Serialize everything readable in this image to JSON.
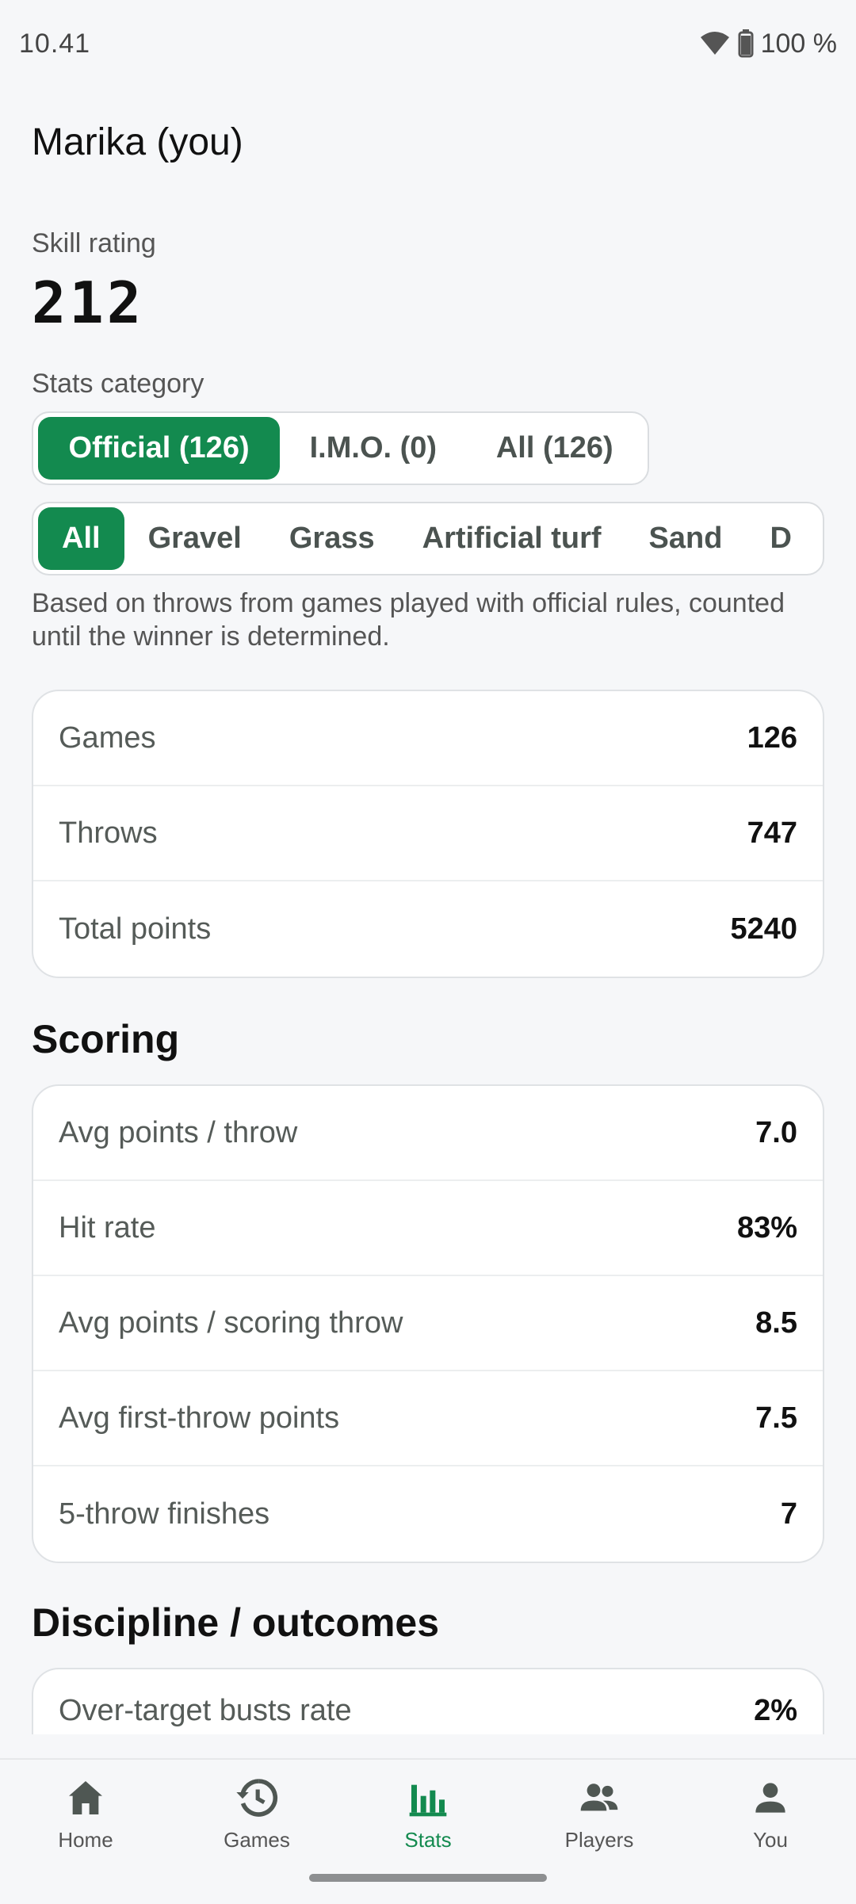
{
  "status_bar": {
    "time": "10.41",
    "battery": "100 %"
  },
  "player": {
    "name": "Marika (you)"
  },
  "skill": {
    "label": "Skill rating",
    "value": "212"
  },
  "stats_category": {
    "label": "Stats category",
    "options": [
      "Official (126)",
      "I.M.O. (0)",
      "All (126)"
    ],
    "selected": "Official (126)"
  },
  "surface_filter": {
    "options": [
      "All",
      "Gravel",
      "Grass",
      "Artificial turf",
      "Sand",
      "D"
    ],
    "selected": "All"
  },
  "note": "Based on throws from games played with official rules, counted until the winner is determined.",
  "summary": [
    {
      "label": "Games",
      "value": "126"
    },
    {
      "label": "Throws",
      "value": "747"
    },
    {
      "label": "Total points",
      "value": "5240"
    }
  ],
  "scoring": {
    "title": "Scoring",
    "rows": [
      {
        "label": "Avg points / throw",
        "value": "7.0"
      },
      {
        "label": "Hit rate",
        "value": "83%"
      },
      {
        "label": "Avg points / scoring throw",
        "value": "8.5"
      },
      {
        "label": "Avg first-throw points",
        "value": "7.5"
      },
      {
        "label": "5-throw finishes",
        "value": "7"
      }
    ]
  },
  "discipline": {
    "title": "Discipline / outcomes",
    "rows": [
      {
        "label": "Over-target busts rate",
        "value": "2%"
      }
    ]
  },
  "bottom_nav": {
    "items": [
      {
        "label": "Home",
        "icon": "home-icon"
      },
      {
        "label": "Games",
        "icon": "history-icon"
      },
      {
        "label": "Stats",
        "icon": "bar-chart-icon"
      },
      {
        "label": "Players",
        "icon": "group-icon"
      },
      {
        "label": "You",
        "icon": "person-icon"
      }
    ],
    "active": "Stats"
  },
  "colors": {
    "accent": "#138a4f",
    "background": "#f6f7f9"
  }
}
